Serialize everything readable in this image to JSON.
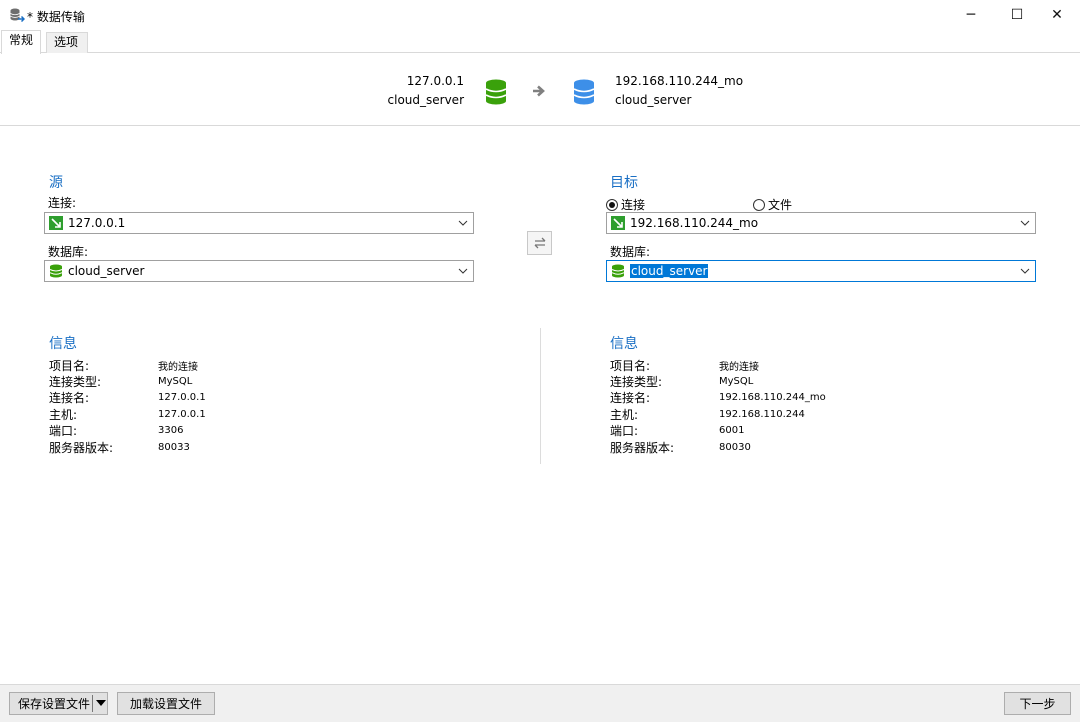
{
  "window": {
    "title": "* 数据传输",
    "controls": {
      "minimize": "─",
      "maximize": "☐",
      "close": "✕"
    }
  },
  "tabs": [
    {
      "label": "常规",
      "active": true
    },
    {
      "label": "选项",
      "active": false
    }
  ],
  "header": {
    "source": {
      "host": "127.0.0.1",
      "database": "cloud_server",
      "icon": "database-green-icon"
    },
    "target": {
      "host": "192.168.110.244_mo",
      "database": "cloud_server",
      "icon": "database-blue-icon"
    },
    "arrow_icon": "arrow-right-icon"
  },
  "source": {
    "section_title": "源",
    "connection_label": "连接:",
    "connection_value": "127.0.0.1",
    "database_label": "数据库:",
    "database_value": "cloud_server"
  },
  "target": {
    "section_title": "目标",
    "radio_connection": "连接",
    "radio_file": "文件",
    "radio_selected": "connection",
    "connection_value": "192.168.110.244_mo",
    "database_label": "数据库:",
    "database_value": "cloud_server"
  },
  "swap_icon": "swap-arrows-icon",
  "source_info": {
    "title": "信息",
    "rows": [
      {
        "key": "项目名:",
        "value": "我的连接"
      },
      {
        "key": "连接类型:",
        "value": "MySQL"
      },
      {
        "key": "连接名:",
        "value": "127.0.0.1"
      },
      {
        "key": "主机:",
        "value": "127.0.0.1"
      },
      {
        "key": "端口:",
        "value": "3306"
      },
      {
        "key": "服务器版本:",
        "value": "80033"
      }
    ]
  },
  "target_info": {
    "title": "信息",
    "rows": [
      {
        "key": "项目名:",
        "value": "我的连接"
      },
      {
        "key": "连接类型:",
        "value": "MySQL"
      },
      {
        "key": "连接名:",
        "value": "192.168.110.244_mo"
      },
      {
        "key": "主机:",
        "value": "192.168.110.244"
      },
      {
        "key": "端口:",
        "value": "6001"
      },
      {
        "key": "服务器版本:",
        "value": "80030"
      }
    ]
  },
  "footer": {
    "save_settings": "保存设置文件",
    "load_settings": "加载设置文件",
    "next": "下一步"
  },
  "colors": {
    "accent": "#1a6fc4",
    "db_green": "#3aa10b",
    "db_blue": "#3d8fe8",
    "selection": "#0078d7"
  }
}
